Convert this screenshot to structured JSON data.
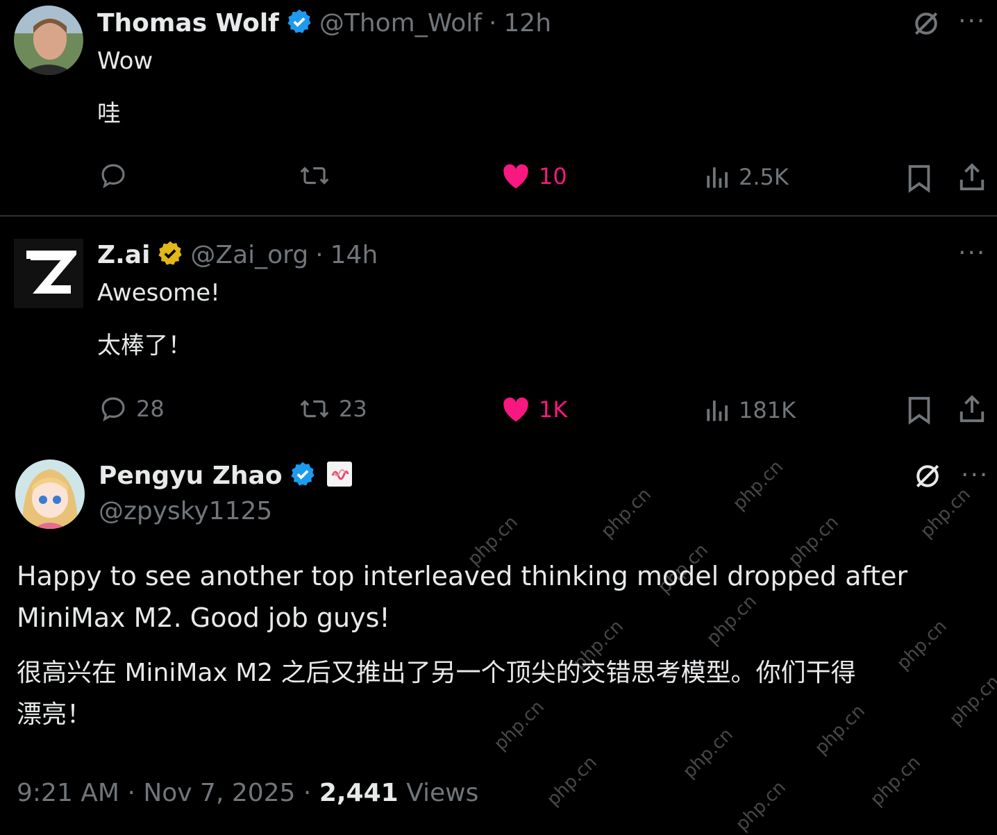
{
  "tweets": [
    {
      "name": "Thomas Wolf",
      "handle": "@Thom_Wolf",
      "time": "12h",
      "lines": [
        "Wow",
        "哇"
      ],
      "reply_count": "",
      "retweet_count": "",
      "like_count": "10",
      "view_count": "2.5K"
    },
    {
      "name": "Z.ai",
      "handle": "@Zai_org",
      "time": "14h",
      "lines": [
        "Awesome!",
        "太棒了！"
      ],
      "reply_count": "28",
      "retweet_count": "23",
      "like_count": "1K",
      "view_count": "181K",
      "avatar_letter": "Z"
    }
  ],
  "main_tweet": {
    "name": "Pengyu Zhao",
    "handle": "@zpysky1125",
    "paragraph_en": [
      "Happy to see another top interleaved thinking model dropped after",
      "MiniMax M2. Good job guys!"
    ],
    "paragraph_zh": [
      "很高兴在 MiniMax M2 之后又推出了另一个顶尖的交错思考模型。你们干得",
      "漂亮！"
    ],
    "time": "9:21 AM",
    "date": "Nov 7, 2025",
    "views_count": "2,441",
    "views_label": "Views"
  },
  "separator": "·",
  "more_label": "···",
  "watermark": "php.cn",
  "colors": {
    "like": "#f91880",
    "verified_blue": "#1d9bf0",
    "verified_gold": "#e2b719",
    "muted": "#71767b"
  },
  "icons": [
    "verified-icon",
    "grok-icon",
    "more-icon",
    "reply-icon",
    "retweet-icon",
    "heart-icon",
    "views-icon",
    "bookmark-icon",
    "share-icon"
  ]
}
